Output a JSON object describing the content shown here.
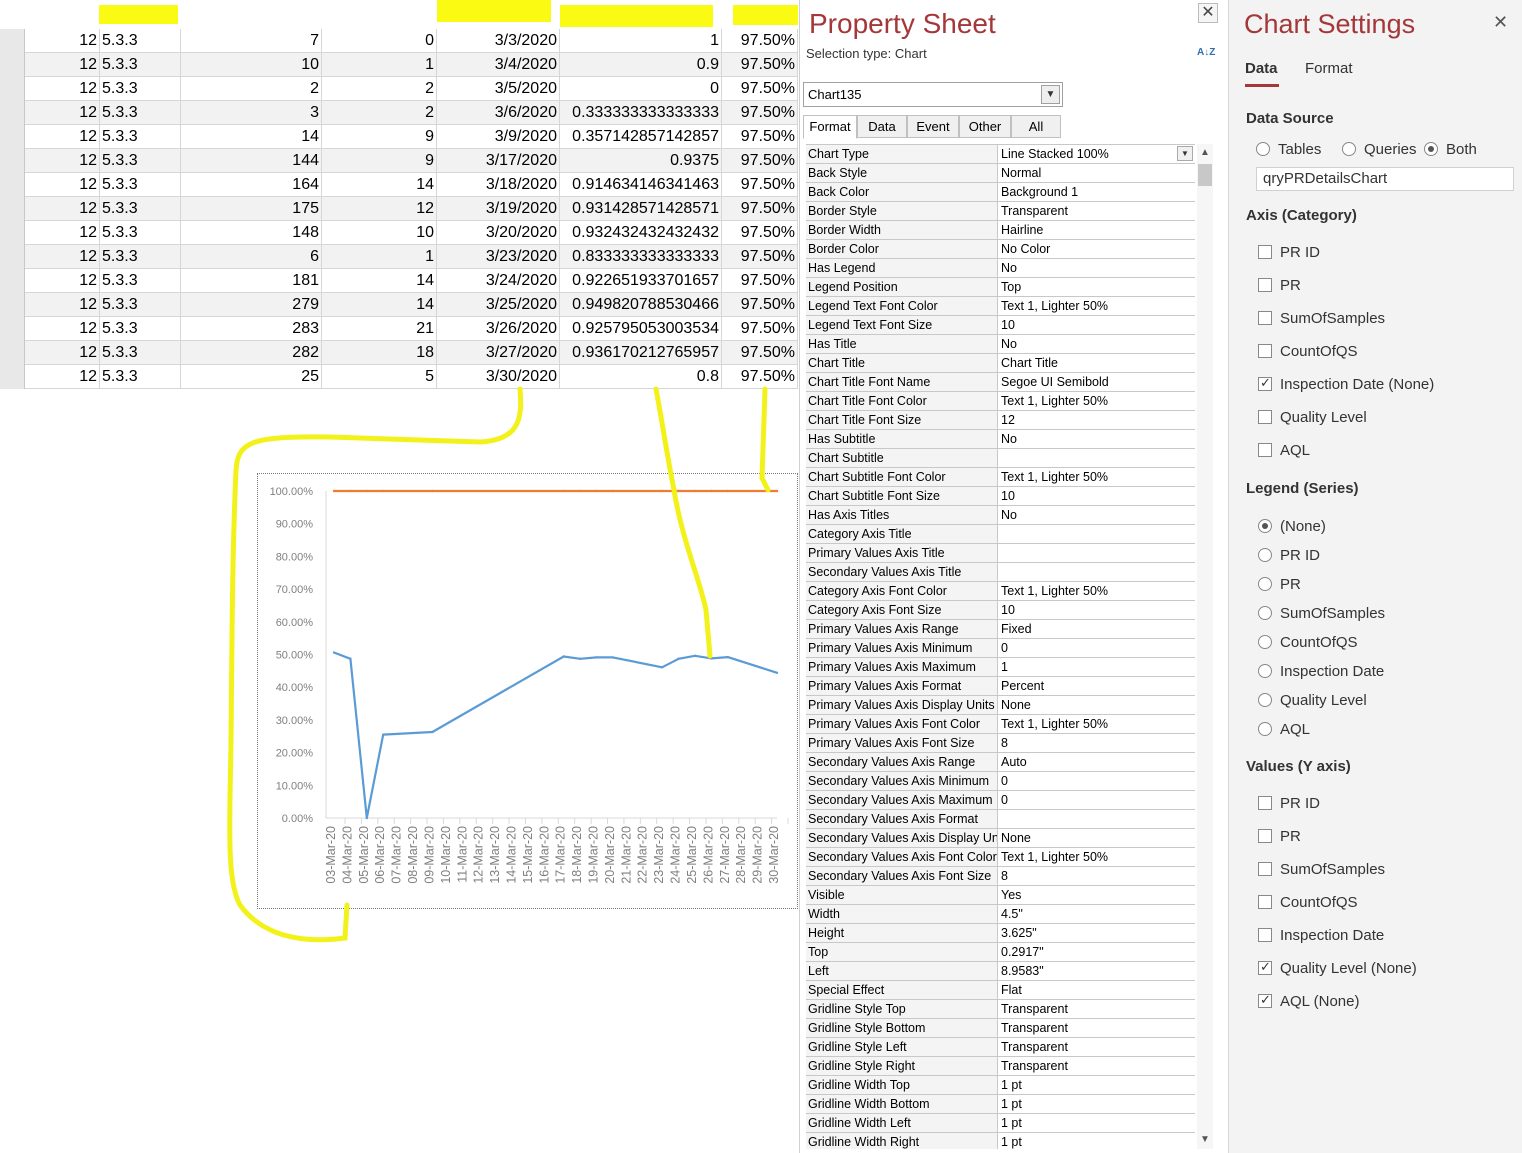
{
  "datasheet": {
    "rows": [
      [
        "12",
        "5.3.3",
        "7",
        "0",
        "3/3/2020",
        "1",
        "97.50%"
      ],
      [
        "12",
        "5.3.3",
        "10",
        "1",
        "3/4/2020",
        "0.9",
        "97.50%"
      ],
      [
        "12",
        "5.3.3",
        "2",
        "2",
        "3/5/2020",
        "0",
        "97.50%"
      ],
      [
        "12",
        "5.3.3",
        "3",
        "2",
        "3/6/2020",
        "0.333333333333333",
        "97.50%"
      ],
      [
        "12",
        "5.3.3",
        "14",
        "9",
        "3/9/2020",
        "0.357142857142857",
        "97.50%"
      ],
      [
        "12",
        "5.3.3",
        "144",
        "9",
        "3/17/2020",
        "0.9375",
        "97.50%"
      ],
      [
        "12",
        "5.3.3",
        "164",
        "14",
        "3/18/2020",
        "0.914634146341463",
        "97.50%"
      ],
      [
        "12",
        "5.3.3",
        "175",
        "12",
        "3/19/2020",
        "0.931428571428571",
        "97.50%"
      ],
      [
        "12",
        "5.3.3",
        "148",
        "10",
        "3/20/2020",
        "0.932432432432432",
        "97.50%"
      ],
      [
        "12",
        "5.3.3",
        "6",
        "1",
        "3/23/2020",
        "0.833333333333333",
        "97.50%"
      ],
      [
        "12",
        "5.3.3",
        "181",
        "14",
        "3/24/2020",
        "0.922651933701657",
        "97.50%"
      ],
      [
        "12",
        "5.3.3",
        "279",
        "14",
        "3/25/2020",
        "0.949820788530466",
        "97.50%"
      ],
      [
        "12",
        "5.3.3",
        "283",
        "21",
        "3/26/2020",
        "0.925795053003534",
        "97.50%"
      ],
      [
        "12",
        "5.3.3",
        "282",
        "18",
        "3/27/2020",
        "0.936170212765957",
        "97.50%"
      ],
      [
        "12",
        "5.3.3",
        "25",
        "5",
        "3/30/2020",
        "0.8",
        "97.50%"
      ]
    ]
  },
  "chart_data": {
    "type": "line",
    "categories": [
      "03-Mar-20",
      "04-Mar-20",
      "05-Mar-20",
      "06-Mar-20",
      "07-Mar-20",
      "08-Mar-20",
      "09-Mar-20",
      "10-Mar-20",
      "11-Mar-20",
      "12-Mar-20",
      "13-Mar-20",
      "14-Mar-20",
      "15-Mar-20",
      "16-Mar-20",
      "17-Mar-20",
      "18-Mar-20",
      "19-Mar-20",
      "20-Mar-20",
      "21-Mar-20",
      "22-Mar-20",
      "23-Mar-20",
      "24-Mar-20",
      "25-Mar-20",
      "26-Mar-20",
      "27-Mar-20",
      "28-Mar-20",
      "29-Mar-20",
      "30-Mar-20"
    ],
    "y_ticks": [
      "0.00%",
      "10.00%",
      "20.00%",
      "30.00%",
      "40.00%",
      "50.00%",
      "60.00%",
      "70.00%",
      "80.00%",
      "90.00%",
      "100.00%"
    ],
    "ylim": [
      0,
      1
    ],
    "series": [
      {
        "color": "#5b9bd5",
        "values": [
          0.506,
          0.487,
          0,
          0.255,
          null,
          null,
          0.263,
          null,
          null,
          null,
          null,
          null,
          null,
          null,
          0.494,
          0.487,
          0.491,
          0.491,
          null,
          null,
          0.461,
          0.487,
          0.496,
          0.488,
          0.492,
          null,
          null,
          0.444
        ]
      },
      {
        "color": "#ed7d31",
        "values": [
          1,
          1,
          1,
          1,
          null,
          null,
          1,
          null,
          null,
          null,
          null,
          null,
          null,
          null,
          1,
          1,
          1,
          1,
          null,
          null,
          1,
          1,
          1,
          1,
          1,
          null,
          null,
          1
        ]
      }
    ],
    "grid": false,
    "legend": "none"
  },
  "property_sheet": {
    "title": "Property Sheet",
    "close": "✕",
    "selection_type": "Selection type:  Chart",
    "sort_label": "A↓Z",
    "object_name": "Chart135",
    "tabs": [
      "Format",
      "Data",
      "Event",
      "Other",
      "All"
    ],
    "properties": [
      [
        "Chart Type",
        "Line Stacked 100%"
      ],
      [
        "Back Style",
        "Normal"
      ],
      [
        "Back Color",
        "Background 1"
      ],
      [
        "Border Style",
        "Transparent"
      ],
      [
        "Border Width",
        "Hairline"
      ],
      [
        "Border Color",
        "No Color"
      ],
      [
        "Has Legend",
        "No"
      ],
      [
        "Legend Position",
        "Top"
      ],
      [
        "Legend Text Font Color",
        "Text 1, Lighter 50%"
      ],
      [
        "Legend Text Font Size",
        "10"
      ],
      [
        "Has Title",
        "No"
      ],
      [
        "Chart Title",
        "Chart Title"
      ],
      [
        "Chart Title Font Name",
        "Segoe UI Semibold"
      ],
      [
        "Chart Title Font Color",
        "Text 1, Lighter 50%"
      ],
      [
        "Chart Title Font Size",
        "12"
      ],
      [
        "Has Subtitle",
        "No"
      ],
      [
        "Chart Subtitle",
        ""
      ],
      [
        "Chart Subtitle Font Color",
        "Text 1, Lighter 50%"
      ],
      [
        "Chart Subtitle Font Size",
        "10"
      ],
      [
        "Has Axis Titles",
        "No"
      ],
      [
        "Category Axis Title",
        ""
      ],
      [
        "Primary Values Axis Title",
        ""
      ],
      [
        "Secondary Values Axis Title",
        ""
      ],
      [
        "Category Axis Font Color",
        "Text 1, Lighter 50%"
      ],
      [
        "Category Axis Font Size",
        "10"
      ],
      [
        "Primary Values Axis Range",
        "Fixed"
      ],
      [
        "Primary Values Axis Minimum",
        "0"
      ],
      [
        "Primary Values Axis Maximum",
        "1"
      ],
      [
        "Primary Values Axis Format",
        "Percent"
      ],
      [
        "Primary Values Axis Display Units",
        "None"
      ],
      [
        "Primary Values Axis Font Color",
        "Text 1, Lighter 50%"
      ],
      [
        "Primary Values Axis Font Size",
        "8"
      ],
      [
        "Secondary Values Axis Range",
        "Auto"
      ],
      [
        "Secondary Values Axis Minimum",
        "0"
      ],
      [
        "Secondary Values Axis Maximum",
        "0"
      ],
      [
        "Secondary Values Axis Format",
        ""
      ],
      [
        "Secondary Values Axis Display Units",
        "None"
      ],
      [
        "Secondary Values Axis Font Color",
        "Text 1, Lighter 50%"
      ],
      [
        "Secondary Values Axis Font Size",
        "8"
      ],
      [
        "Visible",
        "Yes"
      ],
      [
        "Width",
        "4.5\""
      ],
      [
        "Height",
        "3.625\""
      ],
      [
        "Top",
        "0.2917\""
      ],
      [
        "Left",
        "8.9583\""
      ],
      [
        "Special Effect",
        "Flat"
      ],
      [
        "Gridline Style Top",
        "Transparent"
      ],
      [
        "Gridline Style Bottom",
        "Transparent"
      ],
      [
        "Gridline Style Left",
        "Transparent"
      ],
      [
        "Gridline Style Right",
        "Transparent"
      ],
      [
        "Gridline Width Top",
        "1 pt"
      ],
      [
        "Gridline Width Bottom",
        "1 pt"
      ],
      [
        "Gridline Width Left",
        "1 pt"
      ],
      [
        "Gridline Width Right",
        "1 pt"
      ]
    ]
  },
  "chart_settings": {
    "title": "Chart Settings",
    "close": "✕",
    "tabs": [
      "Data",
      "Format"
    ],
    "data_source_label": "Data Source",
    "source_options": [
      {
        "label": "Tables",
        "checked": false
      },
      {
        "label": "Queries",
        "checked": false
      },
      {
        "label": "Both",
        "checked": true
      }
    ],
    "source_value": "qryPRDetailsChart",
    "axis_category_label": "Axis (Category)",
    "axis_category": [
      {
        "label": "PR ID",
        "checked": false
      },
      {
        "label": "PR",
        "checked": false
      },
      {
        "label": "SumOfSamples",
        "checked": false
      },
      {
        "label": "CountOfQS",
        "checked": false
      },
      {
        "label": "Inspection Date (None)",
        "checked": true
      },
      {
        "label": "Quality Level",
        "checked": false
      },
      {
        "label": "AQL",
        "checked": false
      }
    ],
    "legend_label": "Legend (Series)",
    "legend": [
      {
        "label": "(None)",
        "checked": true
      },
      {
        "label": "PR ID",
        "checked": false
      },
      {
        "label": "PR",
        "checked": false
      },
      {
        "label": "SumOfSamples",
        "checked": false
      },
      {
        "label": "CountOfQS",
        "checked": false
      },
      {
        "label": "Inspection Date",
        "checked": false
      },
      {
        "label": "Quality Level",
        "checked": false
      },
      {
        "label": "AQL",
        "checked": false
      }
    ],
    "values_label": "Values (Y axis)",
    "values": [
      {
        "label": "PR ID",
        "checked": false
      },
      {
        "label": "PR",
        "checked": false
      },
      {
        "label": "SumOfSamples",
        "checked": false
      },
      {
        "label": "CountOfQS",
        "checked": false
      },
      {
        "label": "Inspection Date",
        "checked": false
      },
      {
        "label": "Quality Level (None)",
        "checked": true
      },
      {
        "label": "AQL (None)",
        "checked": true
      }
    ]
  },
  "colors": {
    "accent": "#a4373a",
    "highlighter": "#fafa12"
  }
}
